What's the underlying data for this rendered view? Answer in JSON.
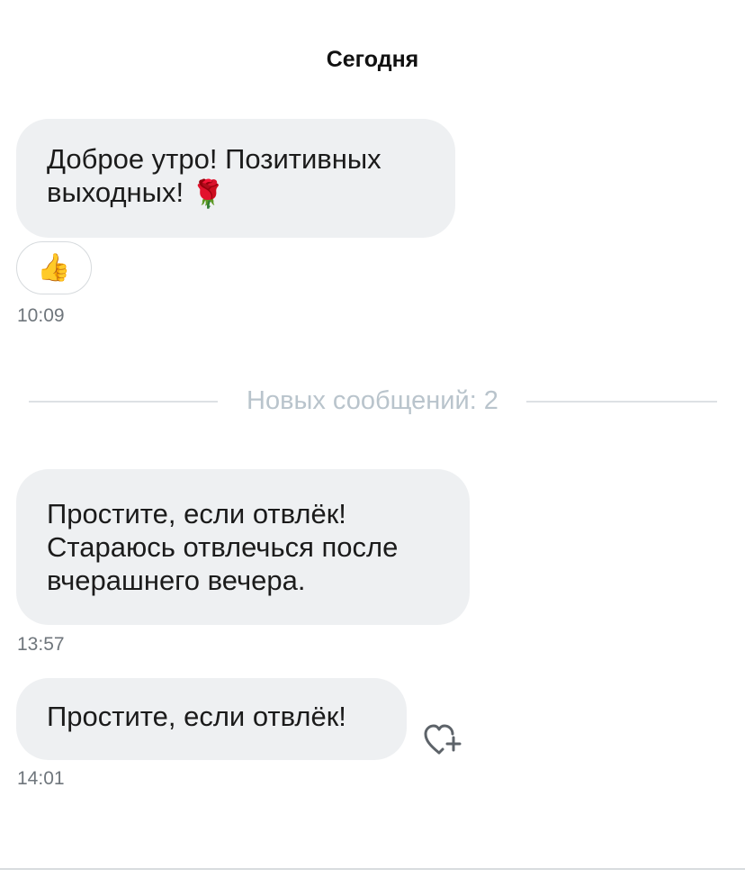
{
  "header": {
    "date": "Сегодня"
  },
  "messages": [
    {
      "text_line1": "Доброе утро! Позитивных",
      "text_line2": "выходных! ",
      "emoji": "🌹",
      "reaction": "👍",
      "time": "10:09"
    },
    {
      "text_line1": "Простите, если отвлёк!",
      "text_line2": "Стараюсь отвлечься после",
      "text_line3": "вчерашнего вечера.",
      "time": "13:57"
    },
    {
      "text_line1": "Простите, если отвлёк!",
      "time": "14:01",
      "reaction_button_icon": "heart-plus-icon"
    }
  ],
  "divider": {
    "label": "Новых сообщений: 2"
  },
  "colors": {
    "bubble_bg": "#eef0f2",
    "time_text": "#6f767c",
    "divider_text": "#b9c4cc",
    "divider_line": "#dde1e4"
  }
}
